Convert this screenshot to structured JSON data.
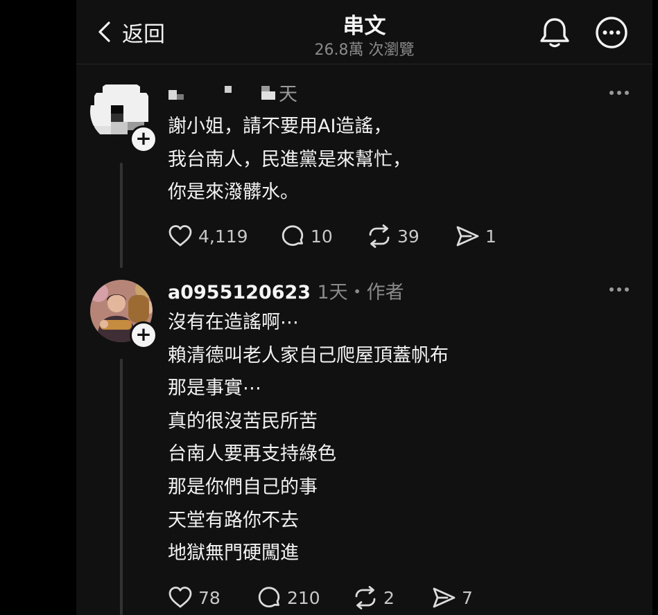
{
  "header": {
    "back_label": "返回",
    "title": "串文",
    "views": "26.8萬 次瀏覽"
  },
  "comment1": {
    "username": "",
    "time": "天",
    "lines": [
      "謝小姐，請不要用AI造謠，",
      "我台南人，民進黨是來幫忙，",
      "你是來潑髒水。"
    ],
    "actions": {
      "likes": "4,119",
      "replies": "10",
      "reposts": "39",
      "shares": "1"
    }
  },
  "reply": {
    "username": "a0955120623",
    "meta": "1天・作者",
    "lines": [
      "沒有在造謠啊⋯",
      "賴清德叫老人家自己爬屋頂蓋帆布",
      "那是事實⋯",
      "真的很沒苦民所苦",
      "台南人要再支持綠色",
      "那是你們自己的事",
      "天堂有路你不去",
      "地獄無門硬闖進"
    ],
    "actions": {
      "likes": "78",
      "replies": "210",
      "reposts": "2",
      "shares": "7"
    }
  },
  "icons": {
    "back": "chevron-left-icon",
    "bell": "bell-icon",
    "more": "more-circle-icon",
    "like": "heart-icon",
    "reply": "speech-bubble-icon",
    "repost": "repost-icon",
    "share": "send-icon"
  }
}
